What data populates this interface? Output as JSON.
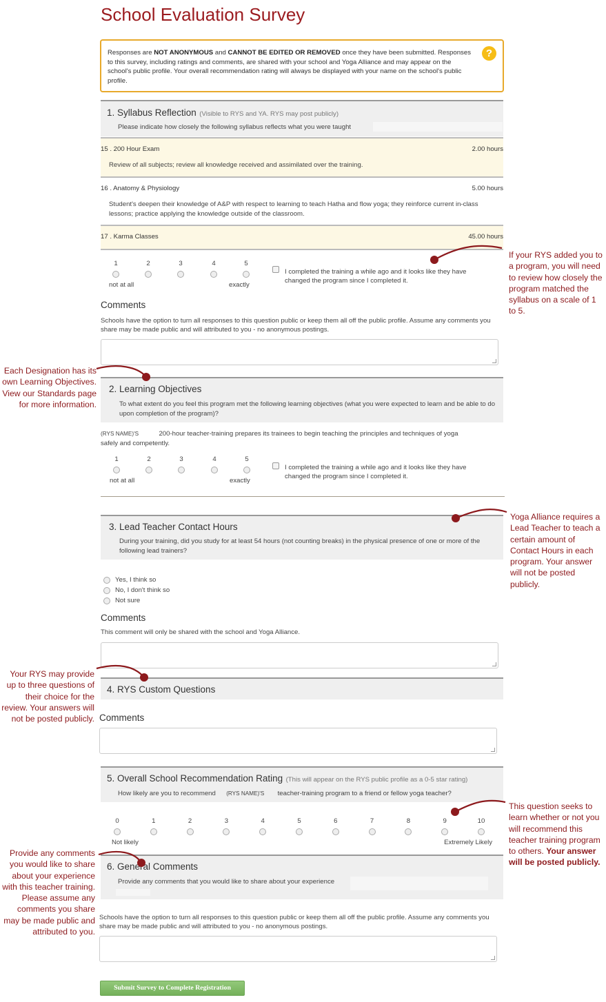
{
  "page_title": "School Evaluation Survey",
  "notice": {
    "part1": "Responses are ",
    "bold1": "NOT ANONYMOUS",
    "part2": " and ",
    "bold2": "CANNOT BE EDITED OR REMOVED",
    "part3": " once they have been submitted. Responses to this survey, including ratings and comments, are shared with your school and Yoga Alliance and may appear on the school's public profile. Your overall recommendation rating will always be displayed with your name on the school's public profile.",
    "help_icon": "question-mark-icon",
    "border_color": "#e8a92a"
  },
  "sections": {
    "s1": {
      "title": "1.  Syllabus Reflection",
      "note": "(Visible to RYS and YA. RYS may post publicly)",
      "subtitle": "Please indicate how closely the following syllabus reflects what you were taught",
      "items": [
        {
          "name": "15 . 200 Hour Exam",
          "hours": "2.00 hours",
          "desc": "Review of all subjects; review all knowledge received and assimilated over the training."
        },
        {
          "name": "16 . Anatomy & Physiology",
          "hours": "5.00 hours",
          "desc": "Student's deepen their knowledge of A&P with respect to learning to teach Hatha and flow yoga; they reinforce current in-class lessons; practice applying the knowledge outside of the classroom."
        },
        {
          "name": "17 . Karma Classes",
          "hours": "45.00 hours",
          "desc": ""
        }
      ],
      "scale": [
        "1",
        "2",
        "3",
        "4",
        "5"
      ],
      "scale_low": "not at all",
      "scale_high": "exactly",
      "checkbox_label": "I completed the training a while ago and it looks like they have changed the program since I completed it.",
      "comments_heading": "Comments",
      "comments_help": "Schools have the option to turn all responses to this question public or keep them all off the public profile. Assume any comments you share may be made public and will attributed to you - no anonymous postings.",
      "comments_value": ""
    },
    "s2": {
      "title": "2. Learning Objectives",
      "subtitle": "To what extent do you feel this program met the following learning objectives (what you were expected to learn and be able to do upon completion of the program)?",
      "objective_rys": "(RYS NAME)'S",
      "objective_text": "200-hour teacher-training prepares its trainees to begin teaching the principles and techniques of yoga",
      "objective_text2": "safely and competently.",
      "scale": [
        "1",
        "2",
        "3",
        "4",
        "5"
      ],
      "scale_low": "not at all",
      "scale_high": "exactly",
      "checkbox_label": "I completed the training a while ago and it looks like they have changed the program since I completed it."
    },
    "s3": {
      "title": "3. Lead Teacher Contact Hours",
      "subtitle": "During your training, did you study for at least 54 hours (not counting breaks) in the physical presence of one or more of the following lead trainers?",
      "options": [
        "Yes, I think so",
        "No, I don't think so",
        "Not sure"
      ],
      "comments_heading": "Comments",
      "comments_help": "This comment will only be shared with the school and Yoga Alliance.",
      "comments_value": ""
    },
    "s4": {
      "title": "4. RYS Custom Questions",
      "comments_heading": "Comments",
      "comments_value": ""
    },
    "s5": {
      "title": "5. Overall School Recommendation Rating",
      "note": "(This will appear on the RYS public profile as a 0-5 star rating)",
      "subtitle_a": "How likely are you to recommend",
      "subtitle_rys": "(RYS NAME)'S",
      "subtitle_b": "teacher-training program to a friend or fellow yoga teacher?",
      "scale": [
        "0",
        "1",
        "2",
        "3",
        "4",
        "5",
        "6",
        "7",
        "8",
        "9",
        "10"
      ],
      "scale_low": "Not likely",
      "scale_high": "Extremely Likely"
    },
    "s6": {
      "title": "6. General Comments",
      "subtitle": "Provide any comments that you would like to share about your experience",
      "comments_help": "Schools have the option to turn all responses to this question public or keep them all off the public profile. Assume any comments you share may be made public and will attributed to you - no anonymous postings.",
      "comments_value": ""
    }
  },
  "submit_label": "Submit Survey to Complete Registration",
  "annotations": {
    "a1": "If your RYS added you to a program, you will need to review how closely the program matched the syllabus on a scale of 1 to 5.",
    "a2": "Each Designation has its own Learning Objectives. View our Standards page for more information.",
    "a3": "Yoga Alliance requires a Lead Teacher to teach a certain amount of Contact Hours in each program. Your answer will not be posted publicly.",
    "a4": "Your RYS may provide up to three questions of their choice for the review. Your answers will not be posted publicly.",
    "a5_text": "This question seeks to learn whether or not you will recommend this teacher training program to others.",
    "a5_bold": "Your answer will be posted publicly.",
    "a6": "Provide any comments you would like to share about your experience with this teacher training. Please assume any comments you share may be made public and attributed to you.",
    "color": "#8d1a1d"
  }
}
